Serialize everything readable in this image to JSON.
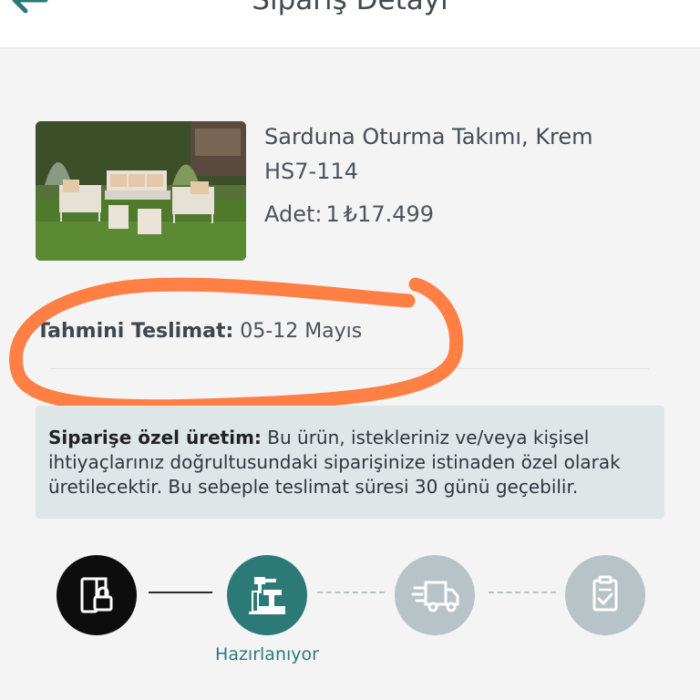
{
  "header": {
    "title": "Sipariş Detayı",
    "back_icon": "arrow-left-icon",
    "accent_color": "#2b7a78"
  },
  "product": {
    "name": "Sarduna Oturma Takımı, Krem",
    "code": "HS7-114",
    "qty_label": "Adet:",
    "qty_value": "1",
    "price": "₺17.499"
  },
  "delivery": {
    "label": "Tahmini Teslimat:",
    "value": "05-12 Mayıs"
  },
  "info": {
    "bold": "Siparişe özel üretim:",
    "text": " Bu ürün, istekleriniz ve/veya kişisel ihtiyaçlarınız doğrultusundaki siparişinize istinaden özel olarak üretilecektir. Bu sebeple teslimat süresi 30 günü geçebilir."
  },
  "steps": [
    {
      "icon": "order-received-icon",
      "state": "done",
      "color": "#0d0d0d"
    },
    {
      "icon": "production-icon",
      "state": "active",
      "color": "#2b7a78",
      "label": "Hazırlanıyor"
    },
    {
      "icon": "delivery-truck-icon",
      "state": "pending",
      "color": "#b8c3c7"
    },
    {
      "icon": "delivered-checklist-icon",
      "state": "pending",
      "color": "#b8c3c7"
    }
  ],
  "annotation_color": "#ff7f45"
}
